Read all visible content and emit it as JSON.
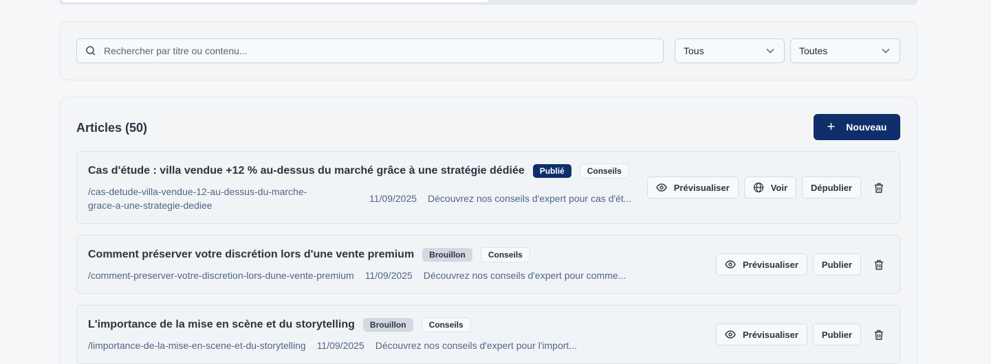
{
  "search": {
    "placeholder": "Rechercher par titre ou contenu..."
  },
  "filters": {
    "status": "Tous",
    "category": "Toutes"
  },
  "list": {
    "title": "Articles (50)",
    "new_label": "Nouveau"
  },
  "actions": {
    "preview": "Prévisualiser",
    "view": "Voir",
    "unpublish": "Dépublier",
    "publish": "Publier"
  },
  "articles": [
    {
      "title": "Cas d'étude : villa vendue +12 % au-dessus du marché grâce à une stratégie dédiée",
      "status": "Publié",
      "category": "Conseils",
      "slug_line1": "/cas-detude-villa-vendue-12-au-dessus-du-marche-",
      "slug_line2": "grace-a-une-strategie-dediee",
      "date": "11/09/2025",
      "excerpt": "Découvrez nos conseils d'expert pour cas d'ét..."
    },
    {
      "title": "Comment préserver votre discrétion lors d'une vente premium",
      "status": "Brouillon",
      "category": "Conseils",
      "slug": "/comment-preserver-votre-discretion-lors-dune-vente-premium",
      "date": "11/09/2025",
      "excerpt": "Découvrez nos conseils d'expert pour comme..."
    },
    {
      "title": "L'importance de la mise en scène et du storytelling",
      "status": "Brouillon",
      "category": "Conseils",
      "slug": "/limportance-de-la-mise-en-scene-et-du-storytelling",
      "date": "11/09/2025",
      "excerpt": "Découvrez nos conseils d'expert pour l'import..."
    }
  ]
}
